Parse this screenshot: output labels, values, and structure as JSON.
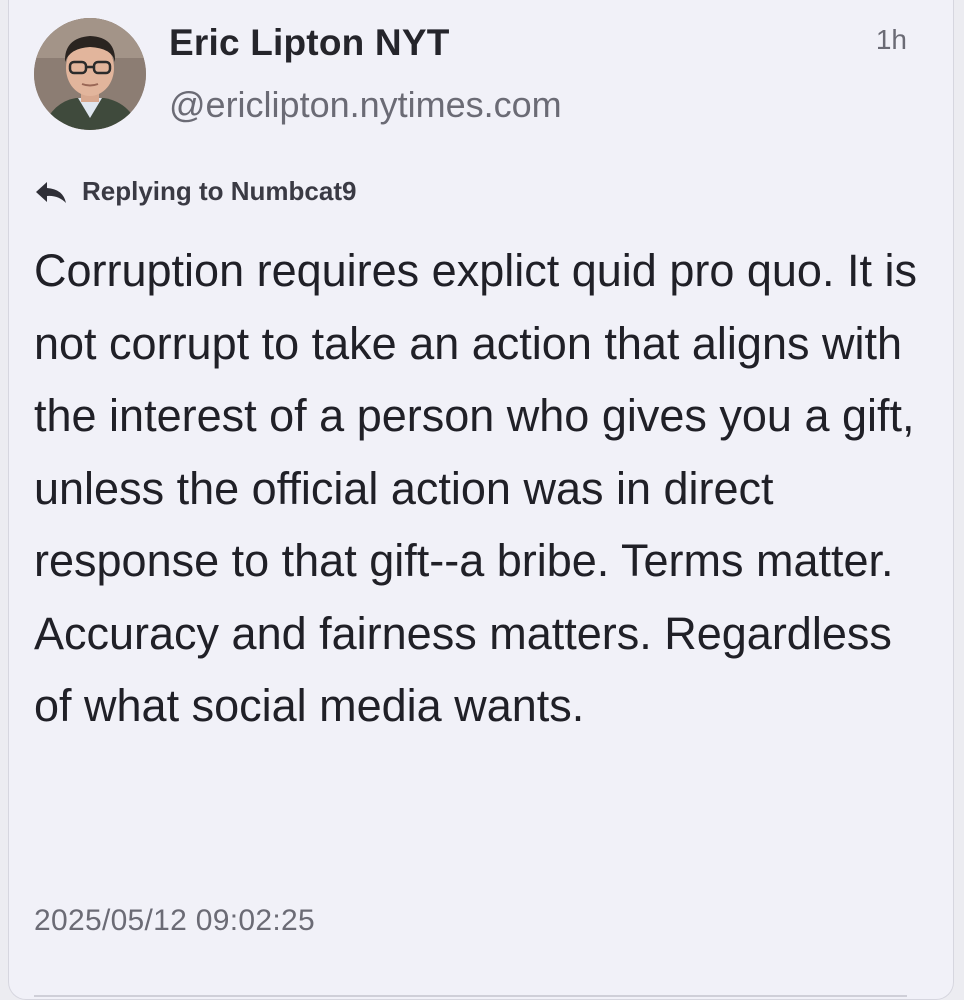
{
  "post": {
    "author": {
      "display_name": "Eric Lipton NYT",
      "handle": "@ericlipton.nytimes.com"
    },
    "relative_time": "1h",
    "reply_to": "Replying to Numbcat9",
    "text": "Corruption requires explict quid pro quo. It is not corrupt to take an action that aligns with the interest of a person who gives you a gift, unless the official action was in direct response to that gift--a bribe. Terms matter. Accuracy and fairness matters. Regardless of what social media wants.",
    "timestamp": "2025/05/12 09:02:25"
  },
  "icons": {
    "avatar": "avatar-photo",
    "reply": "reply-arrow-icon"
  },
  "colors": {
    "card_background": "#f1f1f8",
    "text_primary": "#202027",
    "text_secondary": "#6b6b75"
  }
}
